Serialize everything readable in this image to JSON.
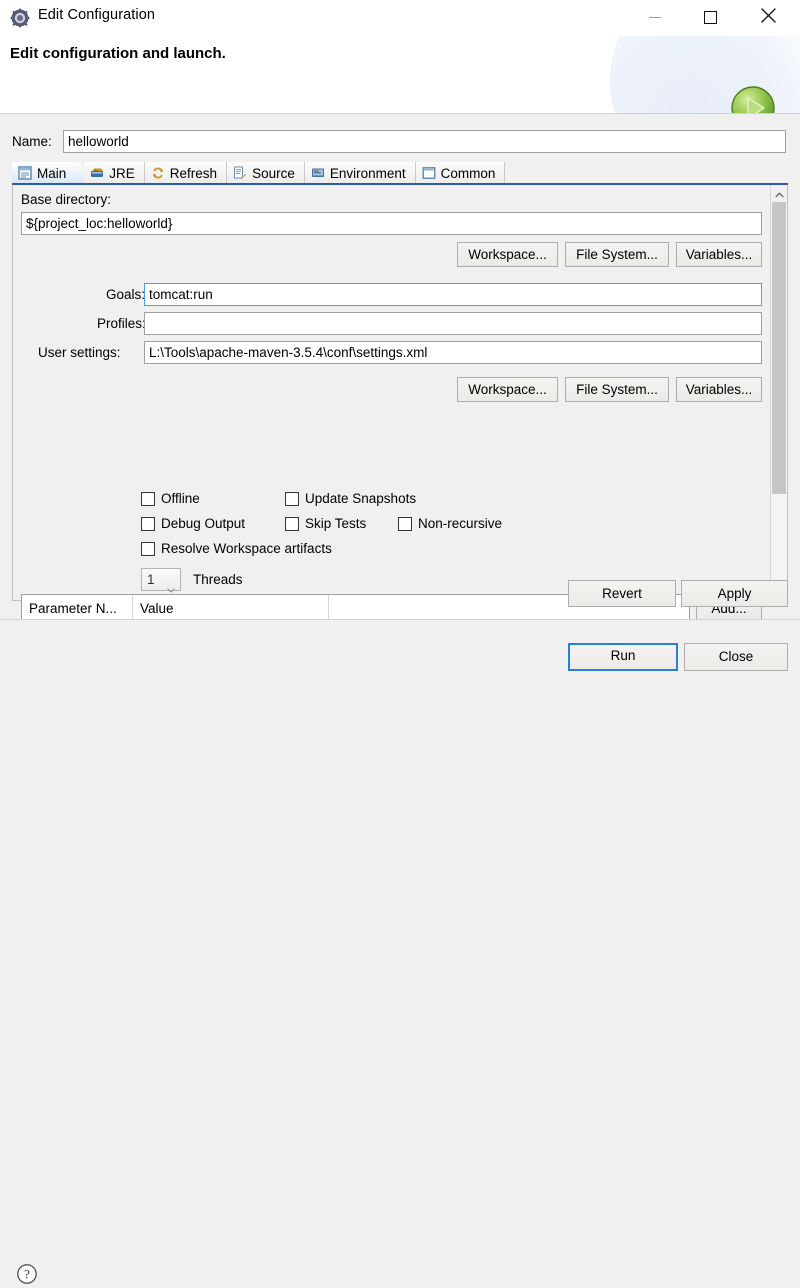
{
  "window": {
    "title": "Edit Configuration",
    "icon": "eclipse-launch-config-icon",
    "minimize_label": "",
    "maximize_label": "",
    "close_label": ""
  },
  "header": {
    "title": "Edit configuration and launch.",
    "badge_icon": "green-run-arrow-icon"
  },
  "name_row": {
    "label": "Name:",
    "value": "helloworld"
  },
  "tabs": [
    {
      "label": "Main",
      "icon": "main-document-icon",
      "selected": true
    },
    {
      "label": "JRE",
      "icon": "jre-library-icon",
      "selected": false
    },
    {
      "label": "Refresh",
      "icon": "refresh-arrows-icon",
      "selected": false
    },
    {
      "label": "Source",
      "icon": "source-lookup-icon",
      "selected": false
    },
    {
      "label": "Environment",
      "icon": "environment-icon",
      "selected": false
    },
    {
      "label": "Common",
      "icon": "common-window-icon",
      "selected": false
    }
  ],
  "main_tab": {
    "base_directory": {
      "label": "Base directory:",
      "value": "${project_loc:helloworld}"
    },
    "dir_buttons": [
      {
        "label": "Workspace..."
      },
      {
        "label": "File System..."
      },
      {
        "label": "Variables..."
      }
    ],
    "goals": {
      "label": "Goals:",
      "value": "tomcat:run",
      "focused": true
    },
    "profiles": {
      "label": "Profiles:",
      "value": ""
    },
    "user_settings": {
      "label": "User settings:",
      "value": "L:\\Tools\\apache-maven-3.5.4\\conf\\settings.xml"
    },
    "settings_buttons": [
      {
        "label": "Workspace..."
      },
      {
        "label": "File System..."
      },
      {
        "label": "Variables..."
      }
    ],
    "checkboxes": [
      {
        "label": "Offline",
        "checked": false
      },
      {
        "label": "Update Snapshots",
        "checked": false
      },
      {
        "label": "Debug Output",
        "checked": false
      },
      {
        "label": "Skip Tests",
        "checked": false
      },
      {
        "label": "Non-recursive",
        "checked": false
      },
      {
        "label": "Resolve Workspace artifacts",
        "checked": false
      }
    ],
    "threads": {
      "value": "1",
      "label": "Threads"
    },
    "parameter_table": {
      "columns": [
        "Parameter N...",
        "Value"
      ],
      "rows": []
    },
    "add_button": {
      "label": "Add..."
    }
  },
  "apply_bar": {
    "revert_label": "Revert",
    "apply_label": "Apply"
  },
  "footer": {
    "help_icon": "help-question-icon",
    "run_label": "Run",
    "close_label": "Close"
  },
  "colors": {
    "accent_blue": "#2b5d9e",
    "focus_blue": "#2a7fd4",
    "dialog_bg": "#f0f0f0",
    "field_bg": "#ffffff",
    "run_green": "#7ac143"
  }
}
